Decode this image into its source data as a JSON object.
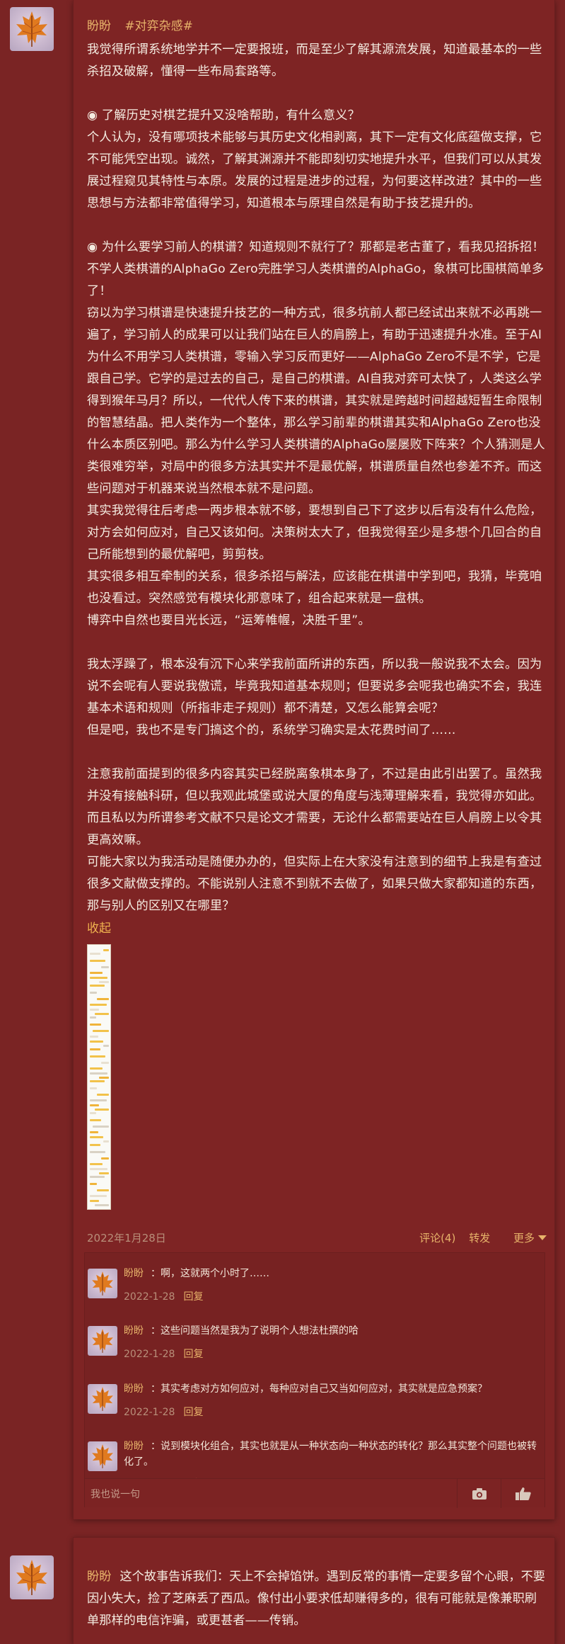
{
  "post": {
    "author": "盼盼",
    "tag": "#对弈杂感#",
    "paragraphs": [
      "我觉得所谓系统地学并不一定要报班，而是至少了解其源流发展，知道最基本的一些杀招及破解，懂得一些布局套路等。",
      "",
      "◉ 了解历史对棋艺提升又没啥帮助，有什么意义？",
      "个人认为，没有哪项技术能够与其历史文化相剥离，其下一定有文化底蕴做支撑，它不可能凭空出现。诚然，了解其渊源并不能即刻切实地提升水平，但我们可以从其发展过程窥见其特性与本原。发展的过程是进步的过程，为何要这样改进？其中的一些思想与方法都非常值得学习，知道根本与原理自然是有助于技艺提升的。",
      "",
      "◉ 为什么要学习前人的棋谱？知道规则不就行了？那都是老古董了，看我见招拆招！不学人类棋谱的AlphaGo Zero完胜学习人类棋谱的AlphaGo，象棋可比围棋简单多了！",
      "窃以为学习棋谱是快速提升技艺的一种方式，很多坑前人都已经试出来就不必再跳一遍了，学习前人的成果可以让我们站在巨人的肩膀上，有助于迅速提升水准。至于AI为什么不用学习人类棋谱，零输入学习反而更好——AlphaGo Zero不是不学，它是跟自己学。它学的是过去的自己，是自己的棋谱。AI自我对弈可太快了，人类这么学得到猴年马月？所以，一代代人传下来的棋谱，其实就是跨越时间超越短暂生命限制的智慧结晶。把人类作为一个整体，那么学习前辈的棋谱其实和AlphaGo Zero也没什么本质区别吧。那么为什么学习人类棋谱的AlphaGo屡屡败下阵来？个人猜测是人类很难穷举，对局中的很多方法其实并不是最优解，棋谱质量自然也参差不齐。而这些问题对于机器来说当然根本就不是问题。",
      "其实我觉得往后考虑一两步根本就不够，要想到自己下了这步以后有没有什么危险，对方会如何应对，自己又该如何。决策树太大了，但我觉得至少是多想个几回合的自己所能想到的最优解吧，剪剪枝。",
      "其实很多相互牵制的关系，很多杀招与解法，应该能在棋谱中学到吧，我猜，毕竟咱也没看过。突然感觉有模块化那意味了，组合起来就是一盘棋。",
      "博弈中自然也要目光长远，“运筹帷幄，决胜千里”。",
      "",
      "我太浮躁了，根本没有沉下心来学我前面所讲的东西，所以我一般说我不太会。因为说不会呢有人要说我傲谎，毕竟我知道基本规则；但要说多会呢我也确实不会，我连基本术语和规则（所指非走子规则）都不清楚，又怎么能算会呢？",
      "但是吧，我也不是专门搞这个的，系统学习确实是太花费时间了……",
      "",
      "注意我前面提到的很多内容其实已经脱离象棋本身了，不过是由此引出罢了。虽然我并没有接触科研，但以我观此城堡或说大厦的角度与浅薄理解来看，我觉得亦如此。而且私以为所谓参考文献不只是论文才需要，无论什么都需要站在巨人肩膀上以令其更高效嘛。",
      "可能大家以为我活动是随便办办的，但实际上在大家没有注意到的细节上我是有查过很多文献做支撑的。不能说别人注意不到就不去做了，如果只做大家都知道的东西，那与别人的区别又在哪里？"
    ],
    "collapse_label": "收起",
    "date": "2022年1月28日",
    "comment_label": "评论(4)",
    "repost_label": "转发",
    "more_label": "更多"
  },
  "comments": [
    {
      "author": "盼盼",
      "text": "：啊，这就两个小时了……",
      "date": "2022-1-28",
      "reply": "回复"
    },
    {
      "author": "盼盼",
      "text": "：这些问题当然是我为了说明个人想法杜撰的哈",
      "date": "2022-1-28",
      "reply": "回复"
    },
    {
      "author": "盼盼",
      "text": "：其实考虑对方如何应对，每种应对自己又当如何应对，其实就是应急预案？",
      "date": "2022-1-28",
      "reply": "回复"
    },
    {
      "author": "盼盼",
      "text": "：说到模块化组合，其实也就是从一种状态向一种状态的转化？那么其实整个问题也被转化了。",
      "date": "2022-1-28",
      "reply": "回复"
    }
  ],
  "reply_bar": {
    "placeholder": "我也说一句"
  },
  "next_post": {
    "author": "盼盼",
    "text": "这个故事告诉我们：天上不会掉馅饼。遇到反常的事情一定要多留个心眼，不要因小失大，捡了芝麻丢了西瓜。像付出小要求低却赚得多的，很有可能就是像兼职刷单那样的电信诈骗，或更甚者——传销。"
  },
  "colors": {
    "background": "#7a2424",
    "accent": "#e7b36a",
    "link": "#f0b24f"
  }
}
